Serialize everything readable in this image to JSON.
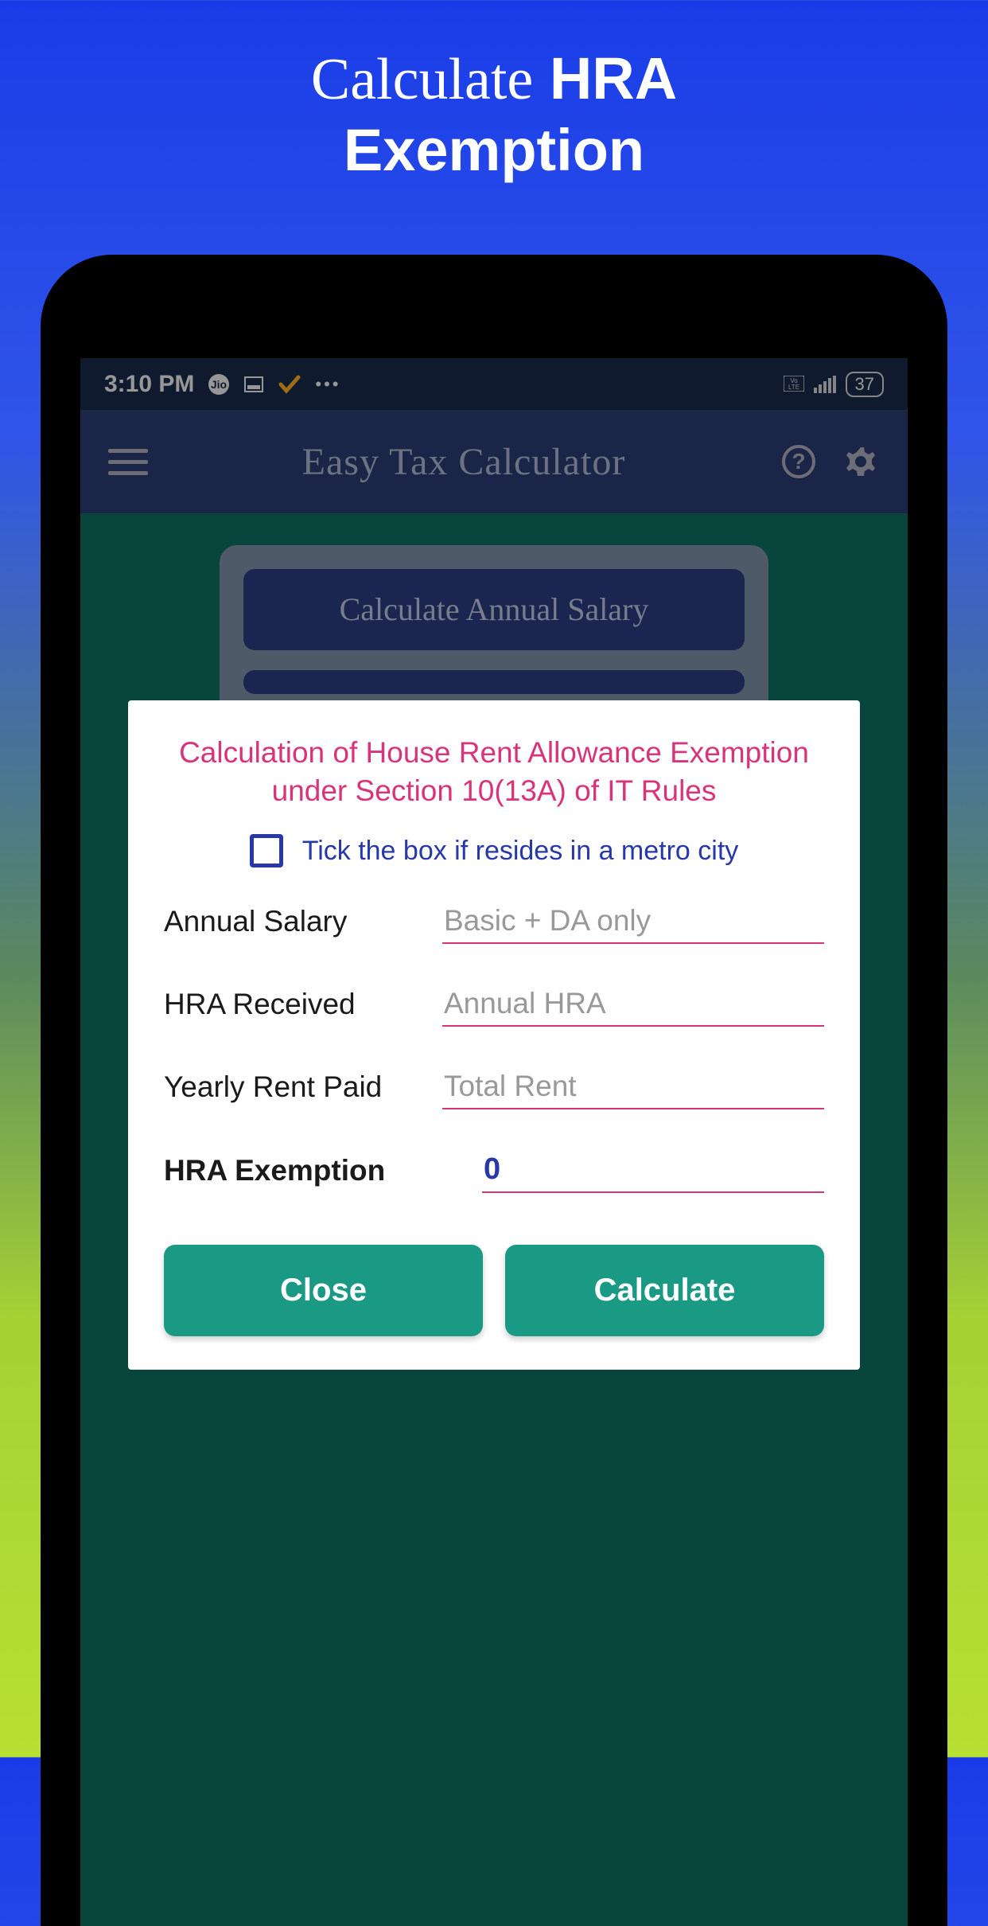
{
  "promo": {
    "line1_light": "Calculate",
    "line1_bold": "HRA",
    "line2_bold": "Exemption"
  },
  "statusBar": {
    "time": "3:10 PM",
    "volte": "Vo LTE",
    "battery": "37"
  },
  "appBar": {
    "title": "Easy Tax Calculator"
  },
  "background": {
    "button1": "Calculate Annual Salary"
  },
  "modal": {
    "title": "Calculation of House Rent Allowance Exemption under Section 10(13A) of IT Rules",
    "checkboxLabel": "Tick the box if resides in a metro city",
    "fields": {
      "annualSalary": {
        "label": "Annual Salary",
        "placeholder": "Basic + DA only"
      },
      "hraReceived": {
        "label": "HRA Received",
        "placeholder": "Annual HRA"
      },
      "yearlyRent": {
        "label": "Yearly Rent Paid",
        "placeholder": "Total Rent"
      },
      "hraExemption": {
        "label": "HRA Exemption",
        "value": "0"
      }
    },
    "closeButton": "Close",
    "calculateButton": "Calculate"
  }
}
